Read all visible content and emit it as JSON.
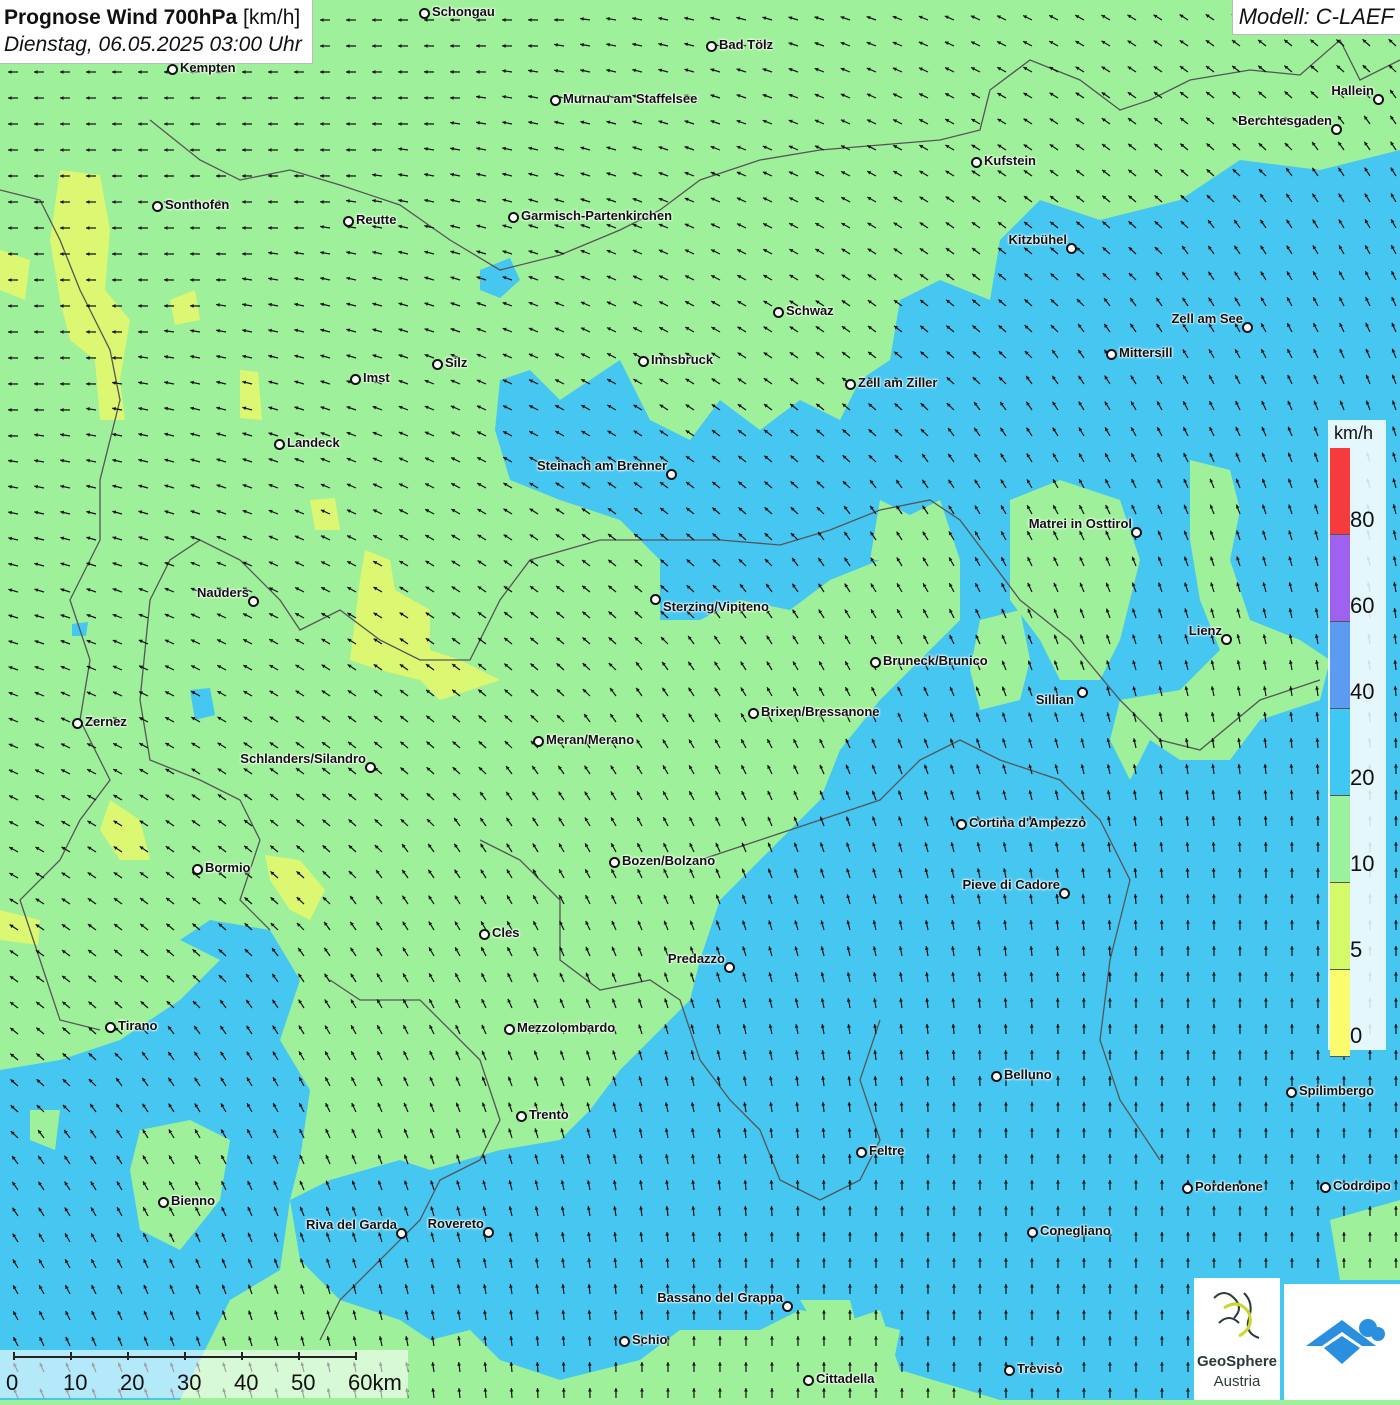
{
  "header": {
    "title_bold": "Prognose Wind 700hPa",
    "title_unit": "[km/h]",
    "subtitle": "Dienstag, 06.05.2025 03:00 Uhr",
    "model": "Modell: C-LAEF"
  },
  "legend": {
    "unit": "km/h",
    "classes": [
      {
        "label": "80",
        "color": "#f53b3b"
      },
      {
        "label": "60",
        "color": "#9f62ef"
      },
      {
        "label": "40",
        "color": "#5b9cf2"
      },
      {
        "label": "20",
        "color": "#3fc8f4"
      },
      {
        "label": "10",
        "color": "#9af39c"
      },
      {
        "label": "5",
        "color": "#d4fa6a"
      },
      {
        "label": "0",
        "color": "#fbfb6e"
      }
    ]
  },
  "scale_bar": {
    "labels": [
      "0",
      "10",
      "20",
      "30",
      "40",
      "50",
      "60km"
    ]
  },
  "logos": {
    "geosphere_line1": "GeoSphere",
    "geosphere_line2": "Austria"
  },
  "cities": [
    {
      "name": "Schongau"
    },
    {
      "name": "Bad Tölz"
    },
    {
      "name": "Kempten"
    },
    {
      "name": "Murnau am Staffelsee"
    },
    {
      "name": "Hallein"
    },
    {
      "name": "Berchtesgaden"
    },
    {
      "name": "Kufstein"
    },
    {
      "name": "Sonthofen"
    },
    {
      "name": "Reutte"
    },
    {
      "name": "Garmisch-Partenkirchen"
    },
    {
      "name": "Kitzbühel"
    },
    {
      "name": "Schwaz"
    },
    {
      "name": "Zell am See"
    },
    {
      "name": "Mittersill"
    },
    {
      "name": "Silz"
    },
    {
      "name": "Innsbruck"
    },
    {
      "name": "Imst"
    },
    {
      "name": "Zell am Ziller"
    },
    {
      "name": "Landeck"
    },
    {
      "name": "Steinach am Brenner"
    },
    {
      "name": "Matrei in Osttirol"
    },
    {
      "name": "Nauders"
    },
    {
      "name": "Sterzing/Vipiteno"
    },
    {
      "name": "Lienz"
    },
    {
      "name": "Bruneck/Brunico"
    },
    {
      "name": "Sillian"
    },
    {
      "name": "Brixen/Bressanone"
    },
    {
      "name": "Zernez"
    },
    {
      "name": "Meran/Merano"
    },
    {
      "name": "Schlanders/Silandro"
    },
    {
      "name": "Cortina d'Ampezzo"
    },
    {
      "name": "Bozen/Bolzano"
    },
    {
      "name": "Bormio"
    },
    {
      "name": "Pieve di Cadore"
    },
    {
      "name": "Cles"
    },
    {
      "name": "Predazzo"
    },
    {
      "name": "Tirano"
    },
    {
      "name": "Mezzolombardo"
    },
    {
      "name": "Belluno"
    },
    {
      "name": "Spilimbergo"
    },
    {
      "name": "Trento"
    },
    {
      "name": "Feltre"
    },
    {
      "name": "Pordenone"
    },
    {
      "name": "Codroipo"
    },
    {
      "name": "Bienno"
    },
    {
      "name": "Riva del Garda"
    },
    {
      "name": "Rovereto"
    },
    {
      "name": "Conegliano"
    },
    {
      "name": "Bassano del Grappa"
    },
    {
      "name": "Schio"
    },
    {
      "name": "Treviso"
    },
    {
      "name": "Cittadella"
    }
  ],
  "wind_arrows": {
    "description_hidden": true
  }
}
